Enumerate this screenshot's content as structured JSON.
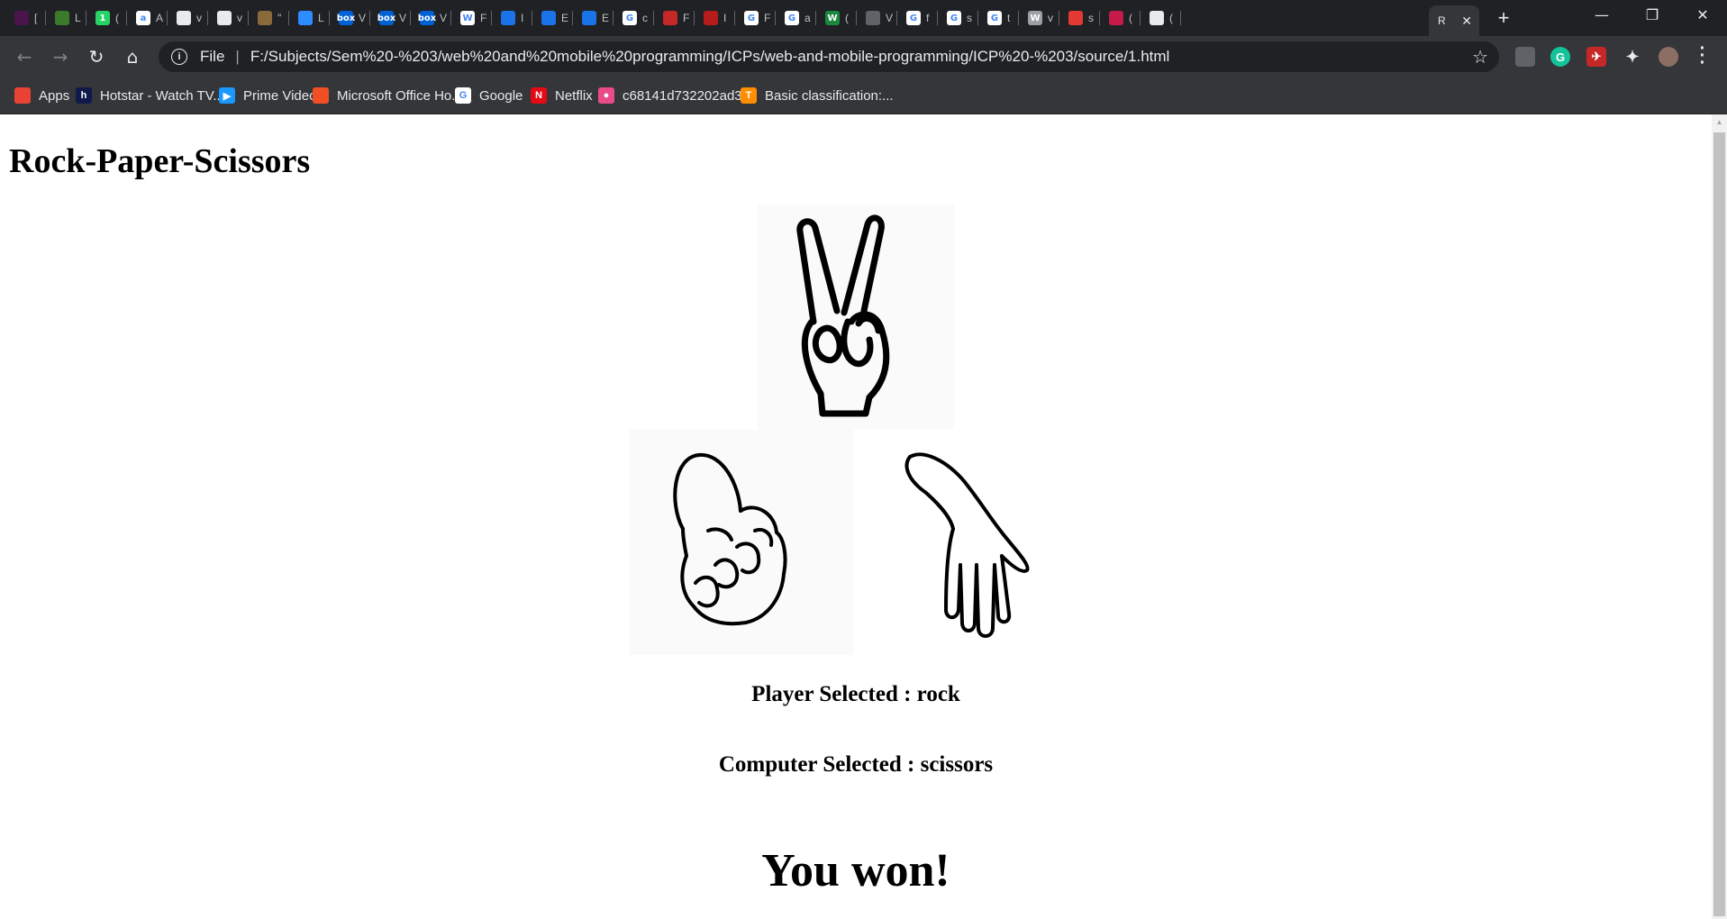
{
  "tabs": [
    {
      "label": "[",
      "icon": "slack-icon",
      "color": "#4a154b"
    },
    {
      "label": "L",
      "icon": "leaf-icon",
      "color": "#3a7a2a"
    },
    {
      "label": "(",
      "icon": "whatsapp-icon",
      "color": "#25d366",
      "glyph": "1"
    },
    {
      "label": "A",
      "icon": "amazon-icon",
      "color": "#ffffff",
      "glyph": "a"
    },
    {
      "label": "v",
      "icon": "github-icon",
      "color": "#e8eaed"
    },
    {
      "label": "v",
      "icon": "github-icon",
      "color": "#e8eaed"
    },
    {
      "label": "\"",
      "icon": "emblem-icon",
      "color": "#8a6a3a"
    },
    {
      "label": "L",
      "icon": "zoom-icon",
      "color": "#2d8cff"
    },
    {
      "label": "V",
      "icon": "box-icon",
      "color": "#0061d5",
      "glyph": "box"
    },
    {
      "label": "V",
      "icon": "box-icon",
      "color": "#0061d5",
      "glyph": "box"
    },
    {
      "label": "V",
      "icon": "box-icon",
      "color": "#0061d5",
      "glyph": "box"
    },
    {
      "label": "F",
      "icon": "wikipedia-icon",
      "color": "#ffffff",
      "glyph": "W"
    },
    {
      "label": "I",
      "icon": "blue-stripe-icon",
      "color": "#1a73e8"
    },
    {
      "label": "E",
      "icon": "blue-stripe-icon",
      "color": "#1a73e8"
    },
    {
      "label": "E",
      "icon": "blue-stripe-icon",
      "color": "#1a73e8"
    },
    {
      "label": "c",
      "icon": "google-icon",
      "color": "#ffffff",
      "glyph": "G"
    },
    {
      "label": "F",
      "icon": "flag-icon",
      "color": "#c62828"
    },
    {
      "label": "I",
      "icon": "shield-crest-icon",
      "color": "#b71c1c"
    },
    {
      "label": "F",
      "icon": "google-icon",
      "color": "#ffffff",
      "glyph": "G"
    },
    {
      "label": "a",
      "icon": "google-icon",
      "color": "#ffffff",
      "glyph": "G"
    },
    {
      "label": "(",
      "icon": "w-green-icon",
      "color": "#1b873f",
      "glyph": "W"
    },
    {
      "label": "V",
      "icon": "globe-icon",
      "color": "#5f6368"
    },
    {
      "label": "f",
      "icon": "google-icon",
      "color": "#ffffff",
      "glyph": "G"
    },
    {
      "label": "s",
      "icon": "google-icon",
      "color": "#ffffff",
      "glyph": "G"
    },
    {
      "label": "t",
      "icon": "google-icon",
      "color": "#ffffff",
      "glyph": "G"
    },
    {
      "label": "v",
      "icon": "w-script-icon",
      "color": "#9aa0a6",
      "glyph": "W"
    },
    {
      "label": "s",
      "icon": "colorwheel-icon",
      "color": "#e53935"
    },
    {
      "label": "(",
      "icon": "raspberry-icon",
      "color": "#c51a4a"
    },
    {
      "label": "(",
      "icon": "github-icon",
      "color": "#e8eaed"
    }
  ],
  "active_tab": {
    "label": "R",
    "close": "✕"
  },
  "new_tab_label": "+",
  "window_controls": {
    "minimize": "—",
    "restore": "❐",
    "close": "✕"
  },
  "omnibox": {
    "scheme": "File",
    "url": "F:/Subjects/Sem%20-%203/web%20and%20mobile%20programming/ICPs/web-and-mobile-programming/ICP%20-%203/source/1.html"
  },
  "bookmarks": [
    {
      "label": "Apps",
      "icon": "apps-grid-icon",
      "color": "#ea4335"
    },
    {
      "label": "Hotstar - Watch TV...",
      "icon": "hotstar-icon",
      "color": "#0f1a4a",
      "glyph": "h"
    },
    {
      "label": "Prime Video",
      "icon": "prime-video-icon",
      "color": "#1a98ff",
      "glyph": "▶"
    },
    {
      "label": "Microsoft Office Ho...",
      "icon": "microsoft-icon",
      "color": "#f25022"
    },
    {
      "label": "Google",
      "icon": "google-icon",
      "color": "#ffffff",
      "glyph": "G"
    },
    {
      "label": "Netflix",
      "icon": "netflix-icon",
      "color": "#e50914",
      "glyph": "N"
    },
    {
      "label": "c68141d732202ad3...",
      "icon": "dribbble-icon",
      "color": "#ea4c89",
      "glyph": "●"
    },
    {
      "label": "Basic classification:...",
      "icon": "tensorflow-icon",
      "color": "#ff8f00",
      "glyph": "T"
    }
  ],
  "page": {
    "title": "Rock-Paper-Scissors",
    "player_line": "Player Selected : rock",
    "computer_line": "Computer Selected : scissors",
    "result": "You won!"
  }
}
